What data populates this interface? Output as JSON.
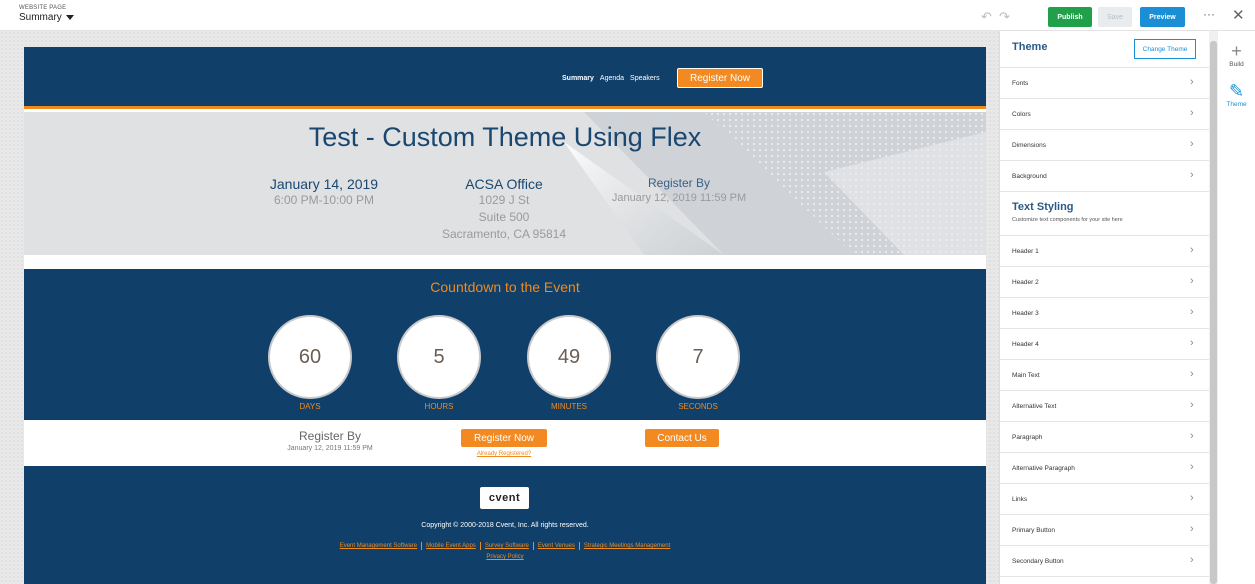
{
  "topbar": {
    "kicker": "WEBSITE PAGE",
    "page": "Summary",
    "undo_icon": "↶",
    "redo_icon": "↷",
    "publish": "Publish",
    "save": "Save",
    "preview": "Preview",
    "more": "···",
    "close": "✕"
  },
  "site": {
    "nav": {
      "links": [
        "Summary",
        "Agenda",
        "Speakers"
      ],
      "register": "Register Now"
    },
    "hero": {
      "title": "Test - Custom Theme Using Flex",
      "date": "January 14, 2019",
      "time": "6:00 PM-10:00 PM",
      "venue": "ACSA Office",
      "address1": "1029 J St",
      "address2": "Suite 500",
      "address3": "Sacramento, CA 95814",
      "register_by": "Register By",
      "register_by_date": "January 12, 2019 11:59 PM"
    },
    "countdown": {
      "title": "Countdown to the Event",
      "units": [
        {
          "value": "60",
          "label": "DAYS"
        },
        {
          "value": "5",
          "label": "HOURS"
        },
        {
          "value": "49",
          "label": "MINUTES"
        },
        {
          "value": "7",
          "label": "SECONDS"
        }
      ]
    },
    "register_band": {
      "title": "Register By",
      "date": "January 12, 2019 11:59 PM",
      "register": "Register Now",
      "already": "Already Registered?",
      "contact": "Contact Us"
    },
    "footer": {
      "logo": "cvent",
      "copyright": "Copyright © 2000-2018 Cvent, Inc. All rights reserved.",
      "links": [
        "Event Management Software",
        "Mobile Event Apps",
        "Survey Software",
        "Event Venues",
        "Strategic Meetings Management"
      ],
      "privacy": "Privacy Policy"
    }
  },
  "panel": {
    "title": "Theme",
    "change_theme": "Change Theme",
    "items_top": [
      "Fonts",
      "Colors",
      "Dimensions",
      "Background"
    ],
    "text_styling": {
      "title": "Text Styling",
      "subtitle": "Customize text components for your site here"
    },
    "items_text": [
      "Header 1",
      "Header 2",
      "Header 3",
      "Header 4",
      "Main Text",
      "Alternative Text",
      "Paragraph",
      "Alternative Paragraph",
      "Links",
      "Primary Button",
      "Secondary Button"
    ],
    "chevron": "›"
  },
  "rail": {
    "build_icon": "+",
    "build": "Build",
    "theme_icon": "✎",
    "theme": "Theme"
  },
  "colors": {
    "navy": "#10406a",
    "orange": "#f28a21",
    "publish": "#21a04a",
    "preview": "#1a8fd6"
  }
}
